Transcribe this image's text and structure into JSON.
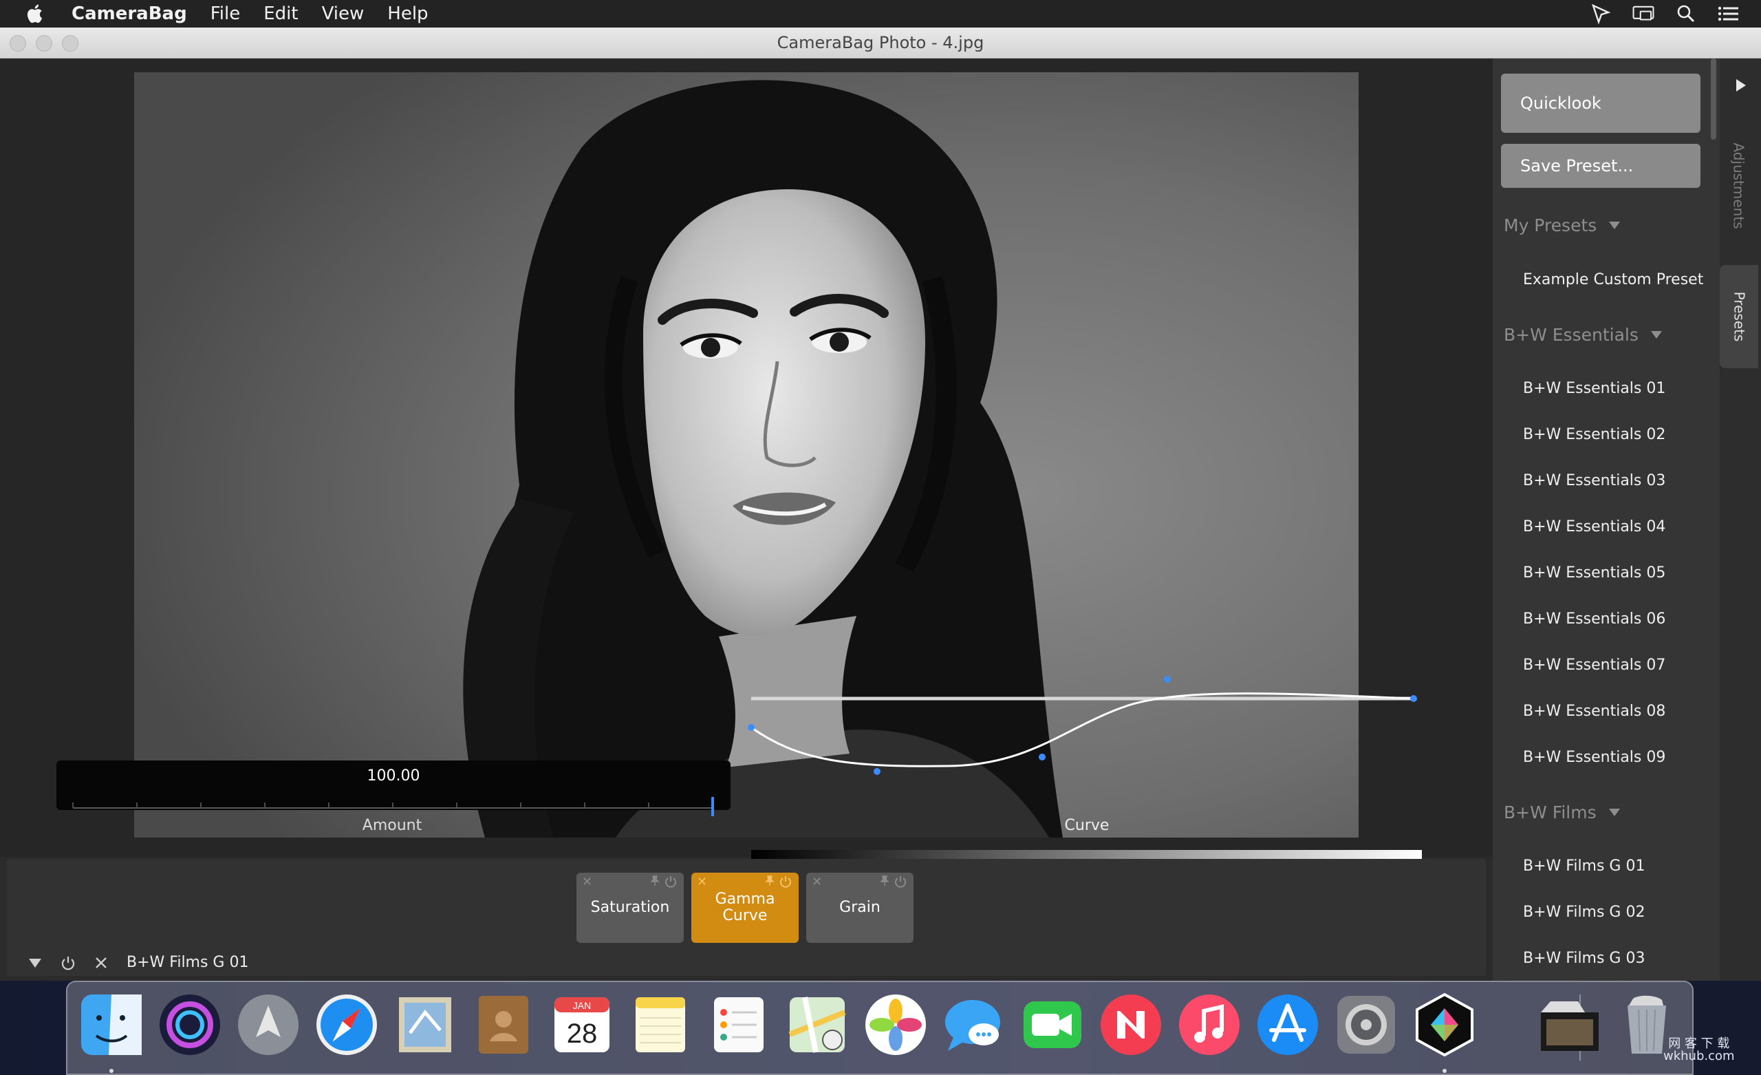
{
  "menubar": {
    "app_name": "CameraBag",
    "items": [
      "File",
      "Edit",
      "View",
      "Help"
    ]
  },
  "window": {
    "title": "CameraBag Photo - 4.jpg"
  },
  "viewer": {
    "amount": {
      "value": "100.00",
      "label": "Amount",
      "fraction": 1.0
    },
    "curve": {
      "label": "Curve"
    }
  },
  "adjustments": {
    "tiles": [
      {
        "label": "Saturation",
        "active": false
      },
      {
        "label": "Gamma\nCurve",
        "active": true
      },
      {
        "label": "Grain",
        "active": false
      }
    ],
    "current_preset": "B+W Films G 01",
    "active_color": "#d38c12"
  },
  "panel": {
    "quicklook_label": "Quicklook",
    "save_preset_label": "Save Preset...",
    "groups": [
      {
        "title": "My Presets",
        "items": [
          "Example Custom Preset"
        ]
      },
      {
        "title": "B+W Essentials",
        "items": [
          "B+W Essentials 01",
          "B+W Essentials 02",
          "B+W Essentials 03",
          "B+W Essentials 04",
          "B+W Essentials 05",
          "B+W Essentials 06",
          "B+W Essentials 07",
          "B+W Essentials 08",
          "B+W Essentials 09"
        ]
      },
      {
        "title": "B+W Films",
        "items": [
          "B+W Films G 01",
          "B+W Films G 02",
          "B+W Films G 03"
        ]
      }
    ],
    "tabs": {
      "adjustments": "Adjustments",
      "presets": "Presets"
    }
  },
  "dock": {
    "apps": [
      "finder-icon",
      "siri-icon",
      "launchpad-icon",
      "safari-icon",
      "mail-icon",
      "contacts-icon",
      "calendar-icon",
      "notes-icon",
      "reminders-icon",
      "maps-icon",
      "photos-icon",
      "messages-icon",
      "facetime-icon",
      "news-icon",
      "music-icon",
      "app-store-icon",
      "system-preferences-icon",
      "camerabag-icon",
      "photo-folder-icon",
      "trash-icon"
    ],
    "calendar": {
      "month": "JAN",
      "day": "28"
    }
  },
  "watermark": {
    "line1": "网 客 下 载",
    "line2": "wkhub.com"
  }
}
